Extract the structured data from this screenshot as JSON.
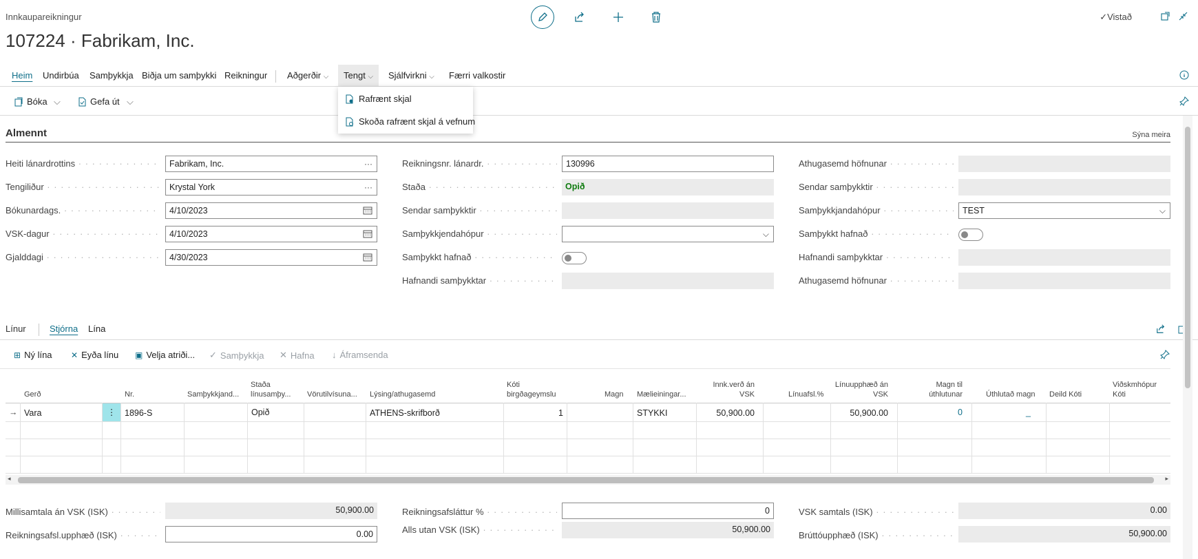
{
  "header": {
    "breadcrumb": "Innkaupareikningur",
    "title": "107224 · Fabrikam, Inc.",
    "saved_label": "Vistað",
    "saved_icon": "checkmark-icon"
  },
  "menu": {
    "items": [
      "Heim",
      "Undirbúa",
      "Samþykkja",
      "Biðja um samþykki",
      "Reikningur",
      "Aðgerðir",
      "Tengt",
      "Sjálfvirkni",
      "Færri valkostir"
    ],
    "active": "Heim",
    "open": "Tengt"
  },
  "actions": {
    "post_label": "Bóka",
    "release_label": "Gefa út"
  },
  "dropdown": {
    "items": [
      "Rafrænt skjal",
      "Skoða rafrænt skjal á vefnum"
    ]
  },
  "general": {
    "title": "Almennt",
    "show_more": "Sýna meira",
    "col1": {
      "vendor_name_label": "Heiti lánardrottins",
      "vendor_name": "Fabrikam, Inc.",
      "contact_label": "Tengiliður",
      "contact": "Krystal York",
      "posting_date_label": "Bókunardags.",
      "posting_date": "4/10/2023",
      "vat_date_label": "VSK-dagur",
      "vat_date": "4/10/2023",
      "due_date_label": "Gjalddagi",
      "due_date": "4/30/2023"
    },
    "col2": {
      "vendor_invoice_label": "Reikningsnr. lánardr.",
      "vendor_invoice": "130996",
      "status_label": "Staða",
      "status": "Opið",
      "sent_for_approval_label": "Sendar samþykktir",
      "approver_group_label": "Samþykkjendahópur",
      "approval_rejected_label": "Samþykkt hafnað",
      "rejecting_approvals_label": "Hafnandi samþykktar"
    },
    "col3": {
      "rejection_comment_label": "Athugasemd höfnunar",
      "sent_for_approval_label": "Sendar samþykktir",
      "approver_group_label": "Samþykkjandahópur",
      "approver_group": "TEST",
      "approval_rejected_label": "Samþykkt hafnað",
      "rejecting_approvals_label": "Hafnandi samþykktar",
      "rejection_comment2_label": "Athugasemd höfnunar"
    }
  },
  "lines": {
    "title": "Línur",
    "tabs": [
      "Stjórna",
      "Lína"
    ],
    "actions": [
      "Ný lína",
      "Eyða línu",
      "Velja atriði...",
      "Samþykkja",
      "Hafna",
      "Áframsenda"
    ],
    "columns": [
      "Gerð",
      "Nr.",
      "Samþykkjand...",
      "Staða línusamþy...",
      "Vörutilvísuna...",
      "Lýsing/athugasemd",
      "Kóti birgðageymslu",
      "Magn",
      "Mælieiningar...",
      "Innk.verð án VSK",
      "Línuafsl.%",
      "Línuupphæð án VSK",
      "Magn til úthlutunar",
      "Úthlutað magn",
      "Deild Kóti",
      "Viðskmhópur Kóti"
    ],
    "row": {
      "type": "Vara",
      "no": "1896-S",
      "status": "Opið",
      "description": "ATHENS-skrifborð",
      "qty": "1",
      "uom": "STYKKI",
      "unit_cost": "50,900.00",
      "line_amount": "50,900.00",
      "qty_to_assign": "0",
      "qty_assigned": "_"
    }
  },
  "totals": {
    "subtotal_label": "Millisamtala án VSK (ISK)",
    "subtotal": "50,900.00",
    "inv_disc_amount_label": "Reikningsafsl.upphæð (ISK)",
    "inv_disc_amount": "0.00",
    "inv_disc_pct_label": "Reikningsafsláttur %",
    "inv_disc_pct": "0",
    "total_excl_vat_label": "Alls utan VSK (ISK)",
    "total_excl_vat": "50,900.00",
    "total_vat_label": "VSK samtals (ISK)",
    "total_vat": "0.00",
    "total_incl_vat_label": "Brúttóupphæð (ISK)",
    "total_incl_vat": "50,900.00"
  },
  "colors": {
    "accent": "#0e6e89",
    "status_green": "#107c10"
  }
}
